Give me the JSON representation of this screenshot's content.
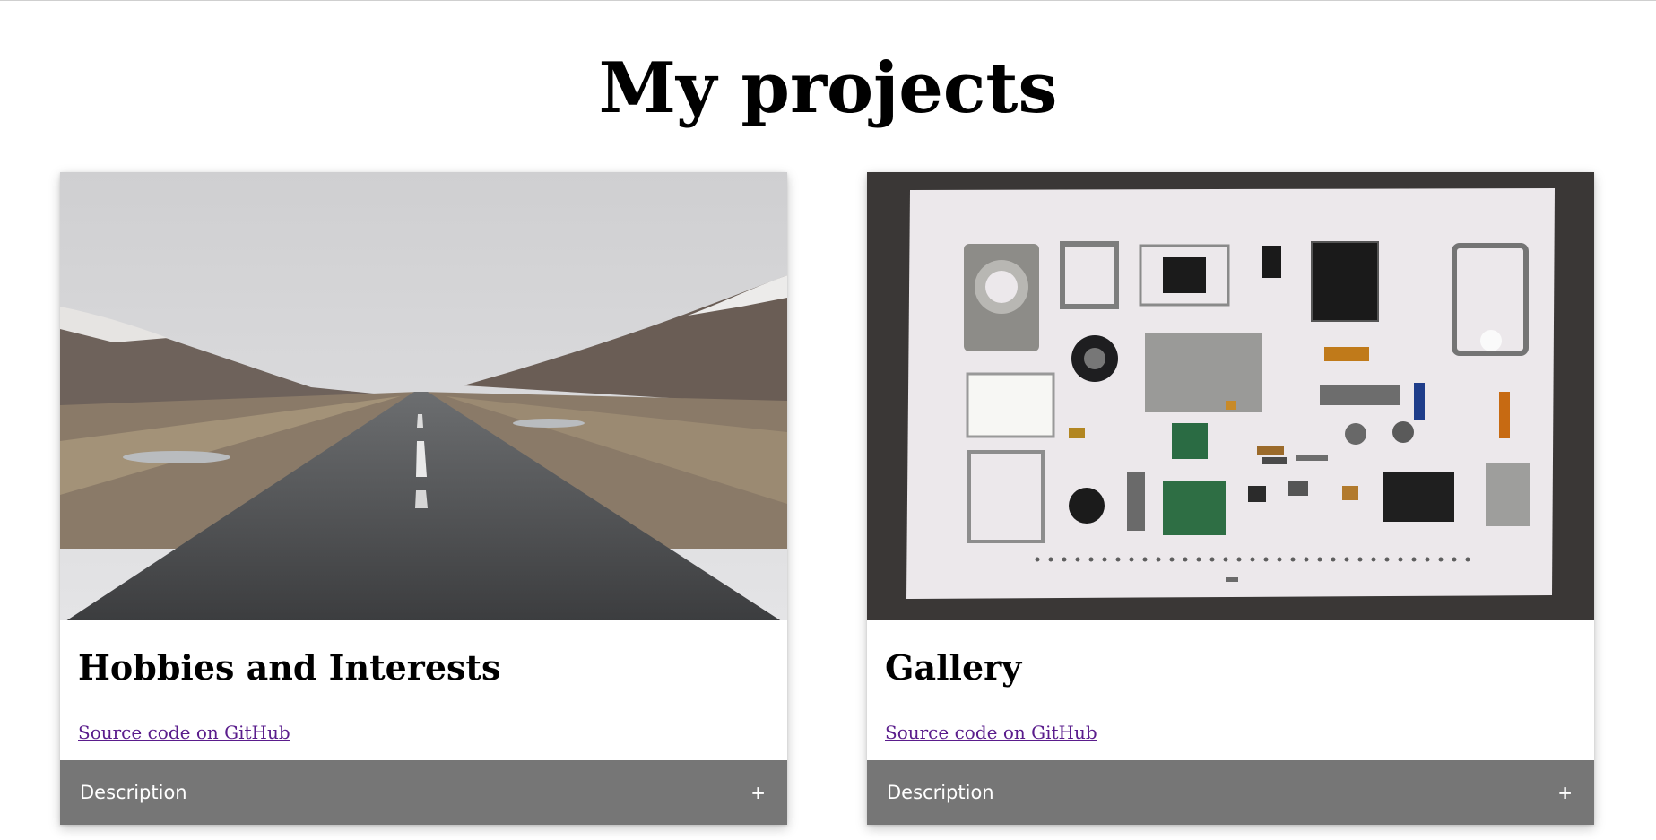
{
  "page": {
    "title": "My projects"
  },
  "projects": [
    {
      "title": "Hobbies and Interests",
      "link_label": "Source code on GitHub",
      "accordion_label": "Description",
      "accordion_icon": "+"
    },
    {
      "title": "Gallery",
      "link_label": "Source code on GitHub",
      "accordion_label": "Description",
      "accordion_icon": "+"
    }
  ]
}
